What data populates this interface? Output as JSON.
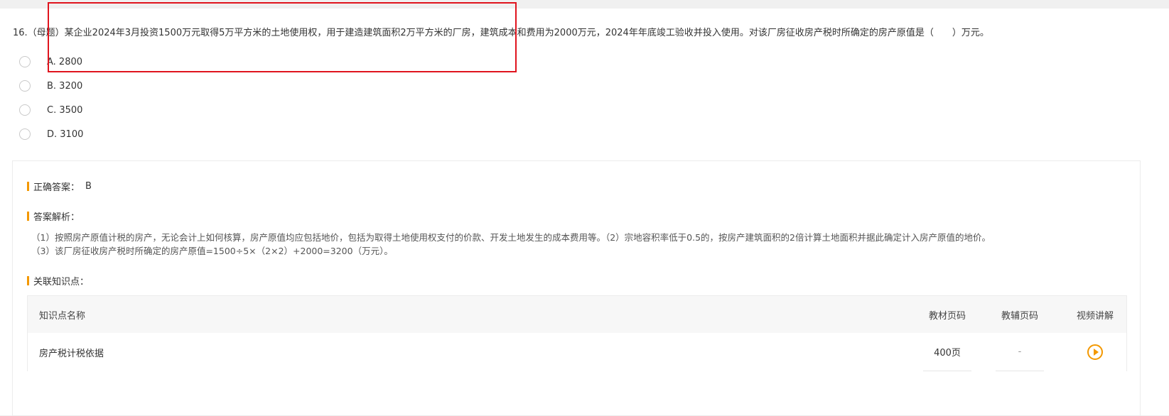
{
  "question": {
    "text": "16.（母题）某企业2024年3月投资1500万元取得5万平方米的土地使用权，用于建造建筑面积2万平方米的厂房，建筑成本和费用为2000万元，2024年年底竣工验收并投入使用。对该厂房征收房产税时所确定的房产原值是（　　）万元。"
  },
  "options": [
    {
      "label": "A. 2800"
    },
    {
      "label": "B. 3200"
    },
    {
      "label": "C. 3500"
    },
    {
      "label": "D. 3100"
    }
  ],
  "answer": {
    "heading": "正确答案：",
    "value": "B"
  },
  "analysis": {
    "heading": "答案解析：",
    "line1": "（1）按照房产原值计税的房产，无论会计上如何核算，房产原值均应包括地价，包括为取得土地使用权支付的价款、开发土地发生的成本费用等。（2）宗地容积率低于0.5的，按房产建筑面积的2倍计算土地面积并据此确定计入房产原值的地价。",
    "line2": "（3）该厂房征收房产税时所确定的房产原值=1500÷5×（2×2）+2000=3200（万元）。"
  },
  "knowledge": {
    "heading": "关联知识点：",
    "columns": {
      "name": "知识点名称",
      "textbook_page": "教材页码",
      "aux_page": "教辅页码",
      "video": "视频讲解"
    },
    "rows": [
      {
        "name": "房产税计税依据",
        "textbook_page": "400页",
        "aux_page": "-",
        "video_icon": "play-icon"
      }
    ]
  },
  "colors": {
    "accent": "#f39800",
    "highlight": "#e0141e"
  }
}
